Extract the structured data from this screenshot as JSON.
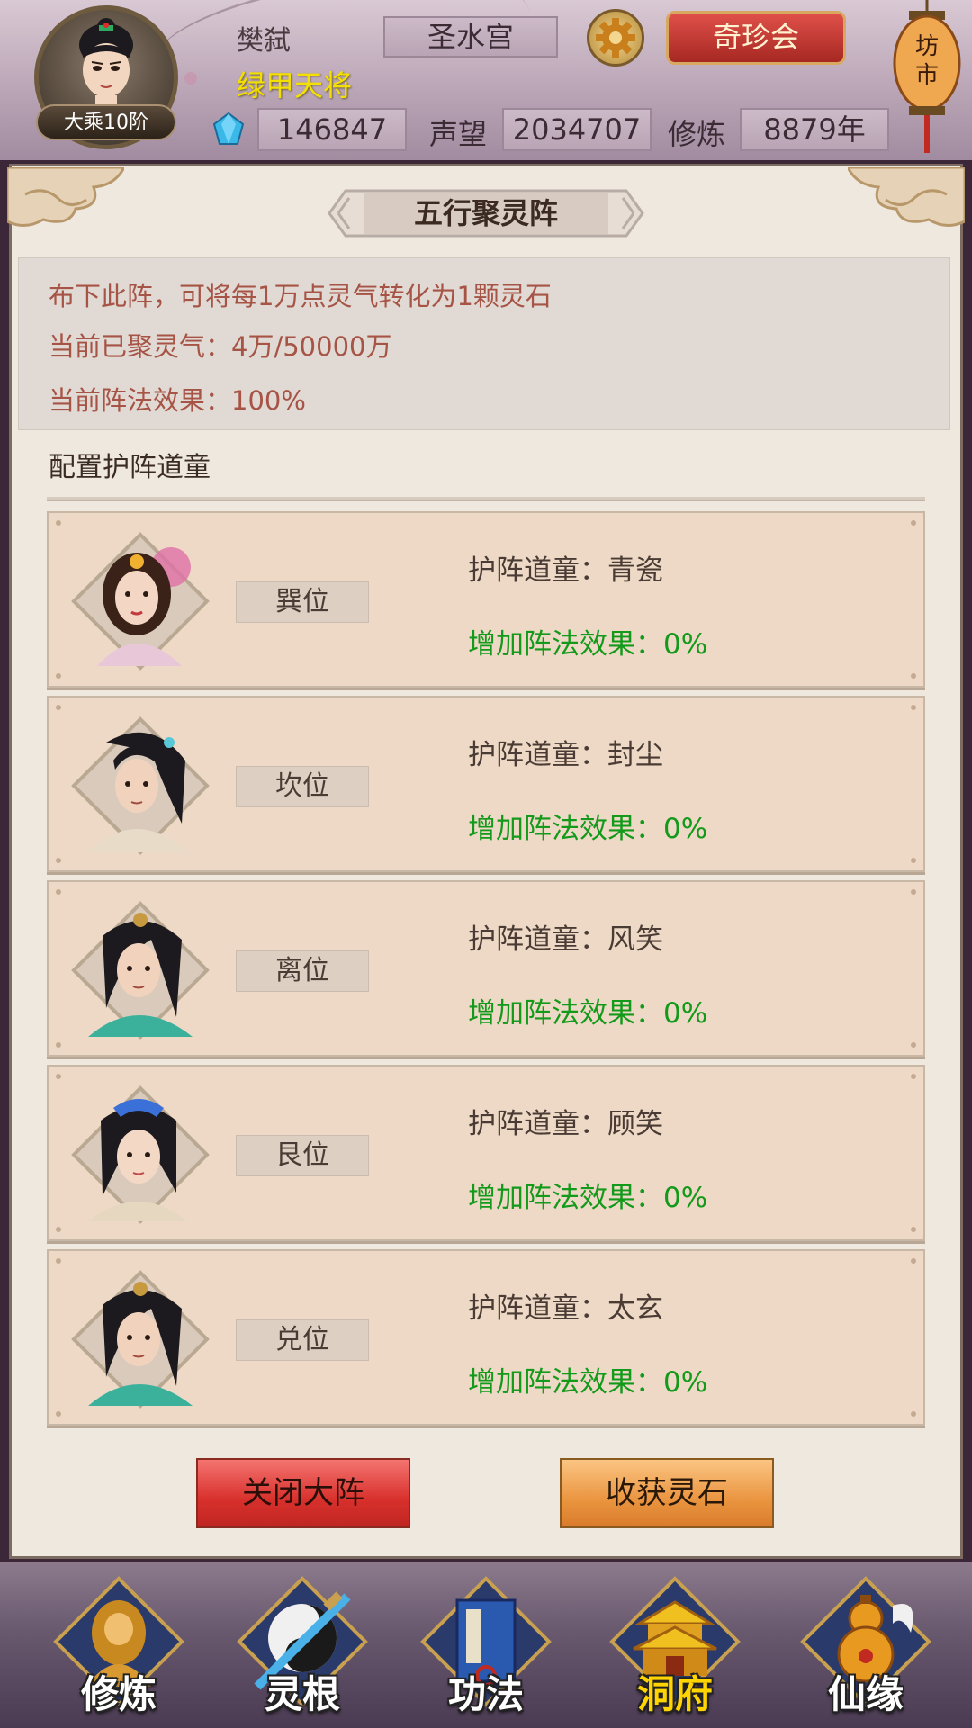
{
  "player": {
    "name": "樊弑",
    "title": "绿甲天将",
    "rank": "大乘10阶",
    "sect": "圣水宫"
  },
  "header": {
    "treasure_button": "奇珍会",
    "market_label": "坊市",
    "gems": "146847",
    "fame_label": "声望",
    "fame": "2034707",
    "cultivation_label": "修炼",
    "cultivation": "8879年"
  },
  "panel": {
    "title": "五行聚灵阵",
    "info_lines": [
      "布下此阵，可将每1万点灵气转化为1颗灵石",
      "当前已聚灵气：4万/50000万",
      "当前阵法效果：100%"
    ],
    "section_label": "配置护阵道童",
    "slots": [
      {
        "position": "巽位",
        "guardian": "护阵道童：青瓷",
        "effect": "增加阵法效果：0%"
      },
      {
        "position": "坎位",
        "guardian": "护阵道童：封尘",
        "effect": "增加阵法效果：0%"
      },
      {
        "position": "离位",
        "guardian": "护阵道童：风笑",
        "effect": "增加阵法效果：0%"
      },
      {
        "position": "艮位",
        "guardian": "护阵道童：顾笑",
        "effect": "增加阵法效果：0%"
      },
      {
        "position": "兑位",
        "guardian": "护阵道童：太玄",
        "effect": "增加阵法效果：0%"
      }
    ],
    "close_button": "关闭大阵",
    "harvest_button": "收获灵石"
  },
  "nav": {
    "items": [
      {
        "label": "修炼",
        "icon": "cultivate-monk-icon"
      },
      {
        "label": "灵根",
        "icon": "spirit-root-sword-icon"
      },
      {
        "label": "功法",
        "icon": "technique-book-icon"
      },
      {
        "label": "洞府",
        "icon": "cave-palace-icon"
      },
      {
        "label": "仙缘",
        "icon": "immortal-gourd-icon"
      }
    ],
    "active": "洞府"
  },
  "colors": {
    "info_text": "#a65446",
    "effect_text": "#139a1a",
    "title_yellow": "#f3e000",
    "close_red": "#d8302c",
    "harvest_orange": "#ea9540",
    "nav_active": "#ffd400"
  }
}
